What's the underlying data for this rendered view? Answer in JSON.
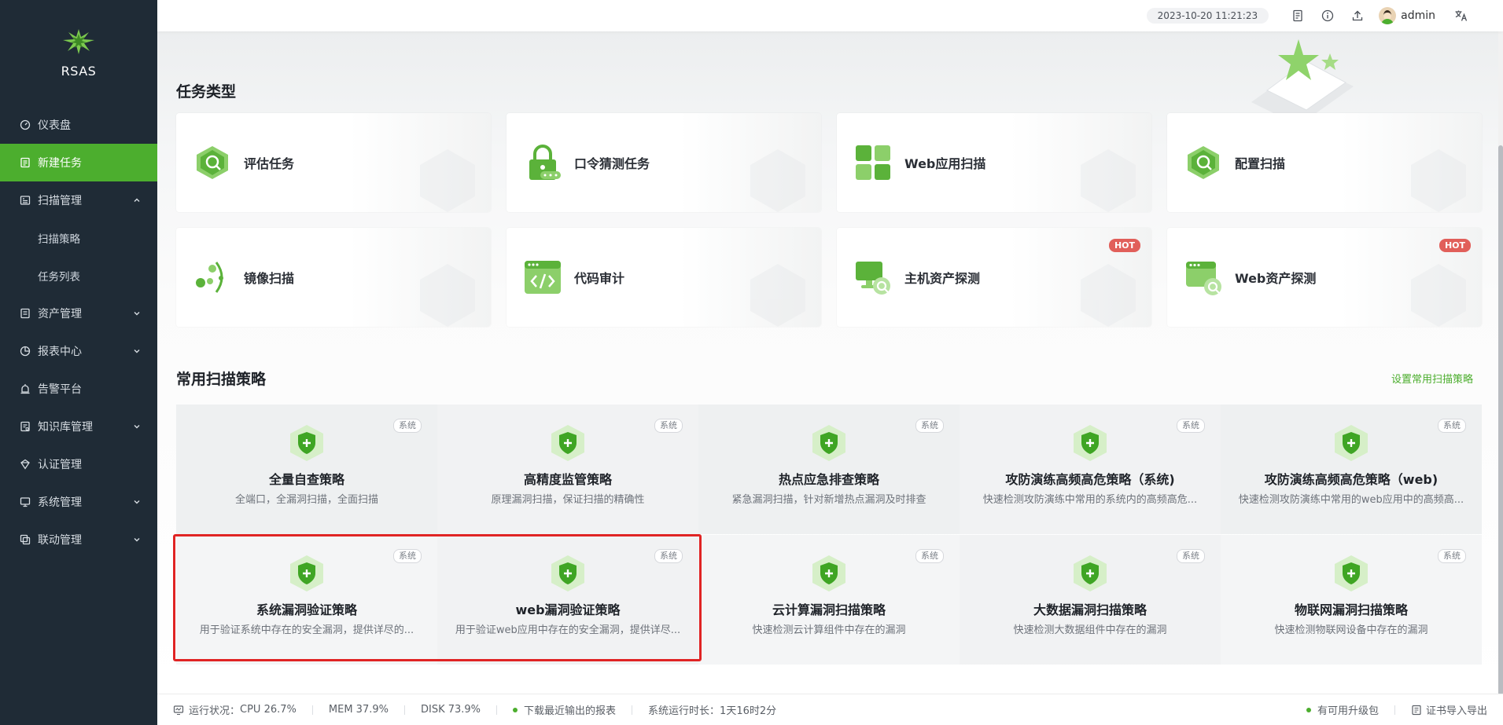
{
  "app": {
    "name": "RSAS"
  },
  "sidebar": {
    "items": [
      {
        "label": "仪表盘",
        "icon": "dashboard-icon"
      },
      {
        "label": "新建任务",
        "icon": "new-task-icon",
        "active": true
      },
      {
        "label": "扫描管理",
        "icon": "scan-management-icon",
        "expanded": true,
        "children": [
          {
            "label": "扫描策略"
          },
          {
            "label": "任务列表"
          }
        ]
      },
      {
        "label": "资产管理",
        "icon": "asset-icon"
      },
      {
        "label": "报表中心",
        "icon": "report-icon"
      },
      {
        "label": "告警平台",
        "icon": "alarm-icon"
      },
      {
        "label": "知识库管理",
        "icon": "knowledge-icon"
      },
      {
        "label": "认证管理",
        "icon": "auth-icon"
      },
      {
        "label": "系统管理",
        "icon": "system-icon"
      },
      {
        "label": "联动管理",
        "icon": "linkage-icon"
      }
    ]
  },
  "topbar": {
    "datetime": "2023-10-20 11:21:23",
    "username": "admin"
  },
  "task_types": {
    "title": "任务类型",
    "cards": [
      {
        "label": "评估任务",
        "icon": "assessment-icon"
      },
      {
        "label": "口令猜测任务",
        "icon": "password-guess-icon"
      },
      {
        "label": "Web应用扫描",
        "icon": "web-app-scan-icon"
      },
      {
        "label": "配置扫描",
        "icon": "config-scan-icon"
      },
      {
        "label": "镜像扫描",
        "icon": "image-scan-icon"
      },
      {
        "label": "代码审计",
        "icon": "code-audit-icon"
      },
      {
        "label": "主机资产探测",
        "icon": "host-asset-icon",
        "badge": "HOT"
      },
      {
        "label": "Web资产探测",
        "icon": "web-asset-icon",
        "badge": "HOT"
      }
    ]
  },
  "policies": {
    "title": "常用扫描策略",
    "action": "设置常用扫描策略",
    "tag": "系统",
    "items": [
      {
        "title": "全量自查策略",
        "desc": "全端口，全漏洞扫描，全面扫描"
      },
      {
        "title": "高精度监管策略",
        "desc": "原理漏洞扫描，保证扫描的精确性"
      },
      {
        "title": "热点应急排查策略",
        "desc": "紧急漏洞扫描，针对新增热点漏洞及时排查"
      },
      {
        "title": "攻防演练高频高危策略（系统)",
        "desc": "快速检测攻防演练中常用的系统内的高频高危..."
      },
      {
        "title": "攻防演练高频高危策略（web)",
        "desc": "快速检测攻防演练中常用的web应用中的高频高..."
      },
      {
        "title": "系统漏洞验证策略",
        "desc": "用于验证系统中存在的安全漏洞，提供详尽的..."
      },
      {
        "title": "web漏洞验证策略",
        "desc": "用于验证web应用中存在的安全漏洞，提供详尽..."
      },
      {
        "title": "云计算漏洞扫描策略",
        "desc": "快速检测云计算组件中存在的漏洞"
      },
      {
        "title": "大数据漏洞扫描策略",
        "desc": "快速检测大数据组件中存在的漏洞"
      },
      {
        "title": "物联网漏洞扫描策略",
        "desc": "快速检测物联网设备中存在的漏洞"
      }
    ]
  },
  "footer": {
    "status_label": "运行状况：",
    "cpu": "CPU 26.7%",
    "mem": "MEM 37.9%",
    "disk": "DISK 73.9%",
    "download_report": "下载最近输出的报表",
    "uptime": "系统运行时长：1天16时2分",
    "upgrade": "有可用升级包",
    "cert": "证书导入导出"
  },
  "colors": {
    "accent": "#4cae2e",
    "sidebar_bg": "#1f2b36",
    "hot": "#e15f5a",
    "highlight": "#e02424"
  }
}
